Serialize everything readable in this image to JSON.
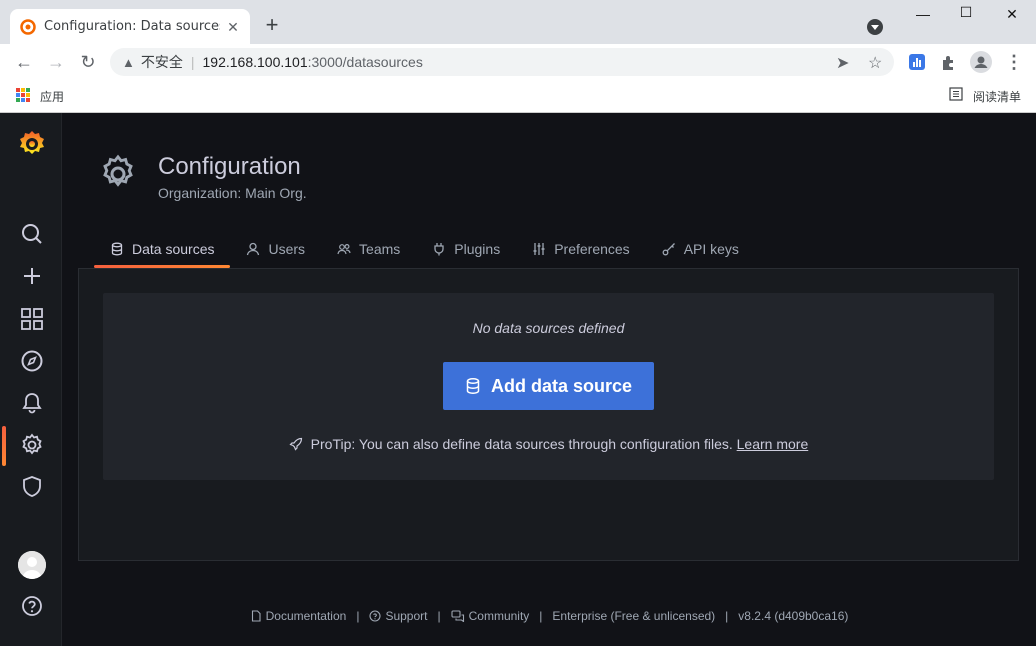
{
  "browser": {
    "tab_title": "Configuration: Data sources - Grafana",
    "url_insecure_label": "不安全",
    "url_host": "192.168.100.101",
    "url_path": ":3000/datasources",
    "bookmark_apps": "应用",
    "reading_list": "阅读清单"
  },
  "page": {
    "title": "Configuration",
    "subtitle": "Organization: Main Org."
  },
  "tabs": [
    {
      "label": "Data sources",
      "icon": "database-icon",
      "active": true
    },
    {
      "label": "Users",
      "icon": "user-icon",
      "active": false
    },
    {
      "label": "Teams",
      "icon": "users-icon",
      "active": false
    },
    {
      "label": "Plugins",
      "icon": "plug-icon",
      "active": false
    },
    {
      "label": "Preferences",
      "icon": "sliders-icon",
      "active": false
    },
    {
      "label": "API keys",
      "icon": "key-icon",
      "active": false
    }
  ],
  "empty_state": {
    "title": "No data sources defined",
    "button_label": "Add data source",
    "protip_text": "ProTip: You can also define data sources through configuration files. ",
    "protip_link": "Learn more"
  },
  "footer": {
    "documentation": "Documentation",
    "support": "Support",
    "community": "Community",
    "enterprise": "Enterprise (Free & unlicensed)",
    "version": "v8.2.4 (d409b0ca16)"
  },
  "colors": {
    "accent": "#3d71d9",
    "brand_gradient": [
      "#f55f3e",
      "#ff8833"
    ],
    "background": "#111217"
  }
}
